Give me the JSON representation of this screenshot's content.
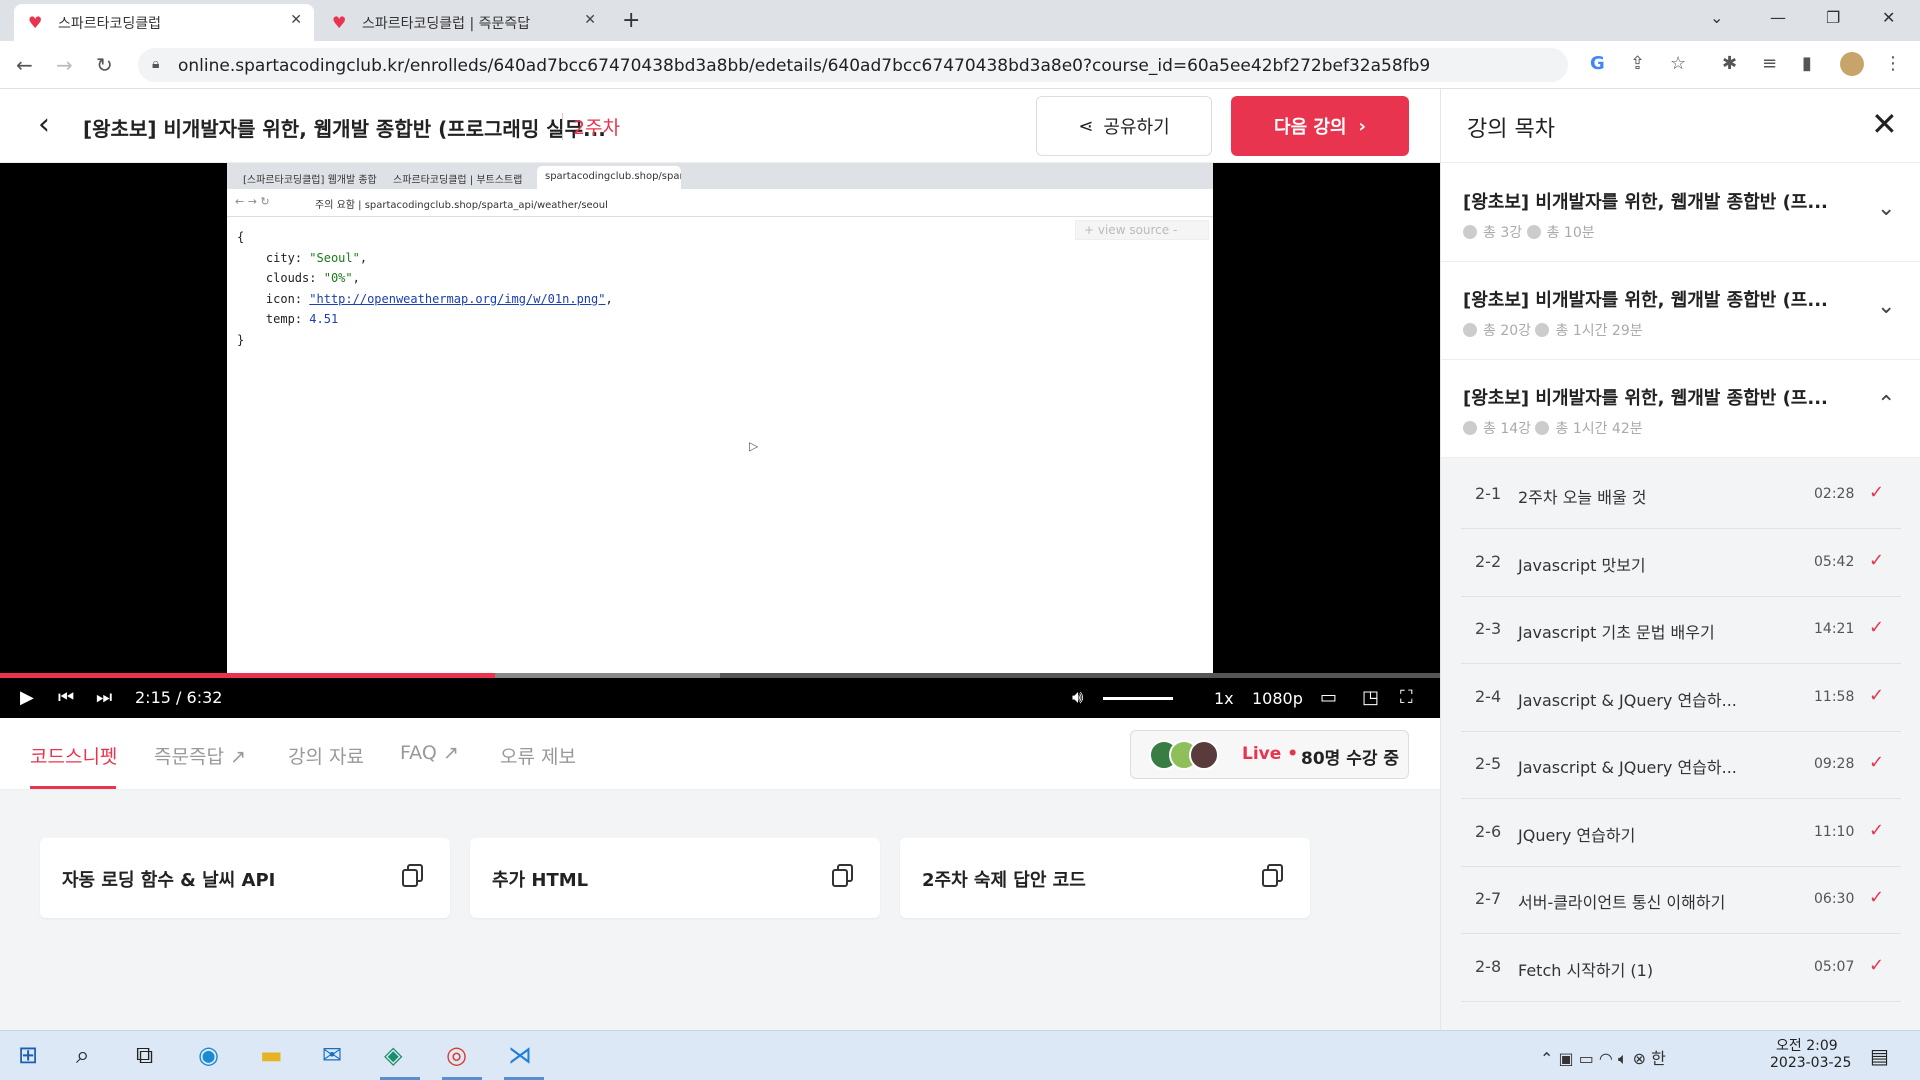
{
  "browser": {
    "tabs": [
      {
        "label": "스파르타코딩클럽",
        "close": "✕"
      },
      {
        "label": "스파르타코딩클럽 | 즉문즉답",
        "close": "✕"
      }
    ],
    "new_tab": "+",
    "url": "online.spartacodingclub.kr/enrolleds/640ad7bcc67470438bd3a8bb/edetails/640ad7bcc67470438bd3a8e0?course_id=60a5ee42bf272bef32a58fb9"
  },
  "header": {
    "back": "‹",
    "course_title": "[왕초보] 비개발자를 위한, 웹개발 종합반 (프로그래밍 실무...",
    "week": "2주차",
    "share_label": "공유하기",
    "next_label": "다음 강의"
  },
  "video": {
    "inner_tabs": [
      "[스파르타코딩클럽] 웹개발 종합",
      "스파르타코딩클럽 | 부트스트랩",
      "spartacodingclub.shop/sparta_a"
    ],
    "inner_url": "주의 요함  |  spartacodingclub.shop/sparta_api/weather/seoul",
    "view_source": "+  view source  -",
    "json_lines": {
      "open": "{",
      "city_key": "city",
      "city_val": "\"Seoul\"",
      "clouds_key": "clouds",
      "clouds_val": "\"0%\"",
      "icon_key": "icon",
      "icon_val": "\"http://openweathermap.org/img/w/01n.png\"",
      "temp_key": "temp",
      "temp_val": "4.51",
      "close": "}"
    },
    "current_time": "2:15",
    "separator": "/",
    "duration": "6:32",
    "progress": 0.344,
    "buffered": 0.5,
    "speed": "1x",
    "quality": "1080p",
    "volume": 0.8
  },
  "subtabs": {
    "items": [
      "코드스니펫",
      "즉문즉답",
      "강의 자료",
      "FAQ",
      "오류 제보"
    ],
    "active": 0,
    "live_label": "Live •",
    "live_count": "80명 수강 중"
  },
  "snippets": [
    {
      "title": "자동 로딩 함수 & 날씨 API"
    },
    {
      "title": "추가 HTML"
    },
    {
      "title": "2주차 숙제 답안 코드"
    }
  ],
  "sidebar": {
    "title": "강의 목차",
    "close": "✕",
    "sections": [
      {
        "title": "[왕초보] 비개발자를 위한, 웹개발 종합반 (프...",
        "count": "총 3강",
        "time": "총 10분",
        "chevron": "⌄"
      },
      {
        "title": "[왕초보] 비개발자를 위한, 웹개발 종합반 (프...",
        "count": "총 20강",
        "time": "총 1시간 29분",
        "chevron": "⌄"
      },
      {
        "title": "[왕초보] 비개발자를 위한, 웹개발 종합반 (프...",
        "count": "총 14강",
        "time": "총 1시간 42분",
        "chevron": "⌃"
      }
    ],
    "lessons": [
      {
        "num": "2-1",
        "title": "2주차 오늘 배울 것",
        "dur": "02:28"
      },
      {
        "num": "2-2",
        "title": "Javascript 맛보기",
        "dur": "05:42"
      },
      {
        "num": "2-3",
        "title": "Javascript 기초 문법 배우기",
        "dur": "14:21"
      },
      {
        "num": "2-4",
        "title": "Javascript & JQuery 연습하...",
        "dur": "11:58"
      },
      {
        "num": "2-5",
        "title": "Javascript & JQuery 연습하...",
        "dur": "09:28"
      },
      {
        "num": "2-6",
        "title": "JQuery 연습하기",
        "dur": "11:10"
      },
      {
        "num": "2-7",
        "title": "서버-클라이언트 통신 이해하기",
        "dur": "06:30"
      },
      {
        "num": "2-8",
        "title": "Fetch 시작하기 (1)",
        "dur": "05:07"
      }
    ],
    "check": "✓"
  },
  "taskbar": {
    "time": "오전 2:09",
    "date": "2023-03-25",
    "ime": "한"
  },
  "colors": {
    "accent": "#e8344e"
  }
}
